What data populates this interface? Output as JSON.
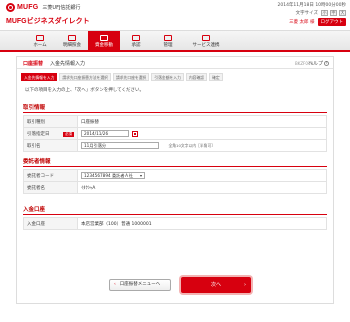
{
  "header": {
    "logo_text": "MUFG",
    "bank_name": "三菱UFJ信託銀行",
    "service_name": "MUFGビジネスダイレクト",
    "datetime": "2014年11月18日 10時00分00秒",
    "font_size_label": "文字サイズ",
    "font_size_buttons": [
      "小",
      "中",
      "大"
    ],
    "user_name": "三菱 太郎 様",
    "logout_label": "ログアウト"
  },
  "nav": {
    "items": [
      {
        "label": "ホーム",
        "icon": "home-icon",
        "active": false
      },
      {
        "label": "明細照会",
        "icon": "statement-icon",
        "active": false
      },
      {
        "label": "資金移動",
        "icon": "transfer-icon",
        "active": true
      },
      {
        "label": "承認",
        "icon": "approve-icon",
        "active": false
      },
      {
        "label": "管理",
        "icon": "manage-icon",
        "active": false
      },
      {
        "label": "サービス連携",
        "icon": "service-icon",
        "active": false
      }
    ]
  },
  "page": {
    "category": "口座振替",
    "title": "入金先情報入力",
    "screen_id": "BKZF010",
    "help_label": "ヘルプ"
  },
  "steps": [
    "入金先情報を入力",
    "請求先口座振替方法を選択",
    "請求先口座を選択",
    "引落金額を入力",
    "内容確認",
    "確定"
  ],
  "instruction": "以下の項目を入力の上、「次へ」ボタンを押してください。",
  "sections": {
    "transaction": {
      "title": "取引情報",
      "type_label": "取引種別",
      "type_value": "口座振替",
      "date_label": "引落指定日",
      "required_badge": "必須",
      "date_value": "2014/11/26",
      "name_label": "取引名",
      "name_value": "11月引落分",
      "name_note": "全角10文字以内［半角可］"
    },
    "company": {
      "title": "委託者情報",
      "code_label": "委託者コード",
      "code_value": "1234567894 委託者Ａ社",
      "name_label": "委託者名",
      "name_value": "ｲﾀｸｼｬA"
    },
    "deposit": {
      "title": "入金口座",
      "account_label": "入金口座",
      "account_value": "本店営業部（100）普通 1000001"
    }
  },
  "buttons": {
    "back_label": "口座振替メニューへ",
    "next_label": "次へ"
  },
  "colors": {
    "brand_red": "#d7000f"
  }
}
